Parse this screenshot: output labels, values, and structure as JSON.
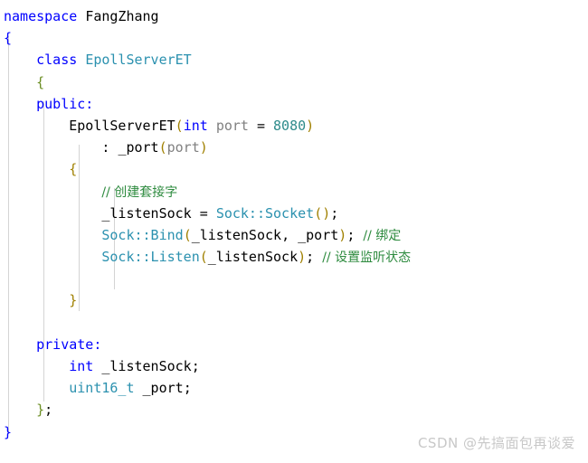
{
  "editor": {
    "language": "cpp",
    "background_color": "#ffffff",
    "font_size_px": 15,
    "line_height_px": 24.2,
    "colors": {
      "keyword": "#0000ff",
      "type": "#2b91af",
      "number": "#2e8b8b",
      "parameter": "#808080",
      "comment": "#2e8b3f",
      "paren": "#a08000",
      "brace_namespace": "#0000ff",
      "brace_class": "#6b8e23",
      "brace_function": "#a08000",
      "plain_text": "#000000",
      "indent_guide": "#d4d4d4",
      "watermark": "#c8c8c8"
    }
  },
  "code": {
    "line_01": {
      "kw": "namespace",
      "name": "FangZhang"
    },
    "line_02": {
      "brace": "{"
    },
    "line_03": {
      "kw": "class",
      "name": "EpollServerET"
    },
    "line_04": {
      "brace": "{"
    },
    "line_05": {
      "label": "public:"
    },
    "line_06": {
      "ctor": "EpollServerET",
      "lparen": "(",
      "type": "int",
      "param": "port",
      "eq": "=",
      "value": "8080",
      "rparen": ")"
    },
    "line_07": {
      "colon": ":",
      "member": "_port",
      "lparen": "(",
      "arg": "port",
      "rparen": ")"
    },
    "line_08": {
      "brace": "{"
    },
    "line_09": {
      "comment": "// 创建套接字"
    },
    "line_10": {
      "lhs": "_listenSock",
      "eq": "=",
      "call": "Sock::Socket",
      "lparen": "(",
      "rparen": ")",
      "semi": ";"
    },
    "line_11": {
      "call": "Sock::Bind",
      "lparen": "(",
      "arg1": "_listenSock",
      "comma": ",",
      "arg2": "_port",
      "rparen": ")",
      "semi": ";",
      "comment": "// 绑定"
    },
    "line_12": {
      "call": "Sock::Listen",
      "lparen": "(",
      "arg1": "_listenSock",
      "rparen": ")",
      "semi": ";",
      "comment": "// 设置监听状态"
    },
    "line_13": {
      "brace": "}"
    },
    "line_14": {
      "label": "private:"
    },
    "line_15": {
      "type": "int",
      "name": "_listenSock",
      "semi": ";"
    },
    "line_16": {
      "type": "uint16_t",
      "name": "_port",
      "semi": ";"
    },
    "line_17": {
      "brace": "}",
      "semi": ";"
    },
    "line_18": {
      "brace": "}"
    }
  },
  "watermark": {
    "text": "CSDN @先搞面包再谈爱"
  }
}
